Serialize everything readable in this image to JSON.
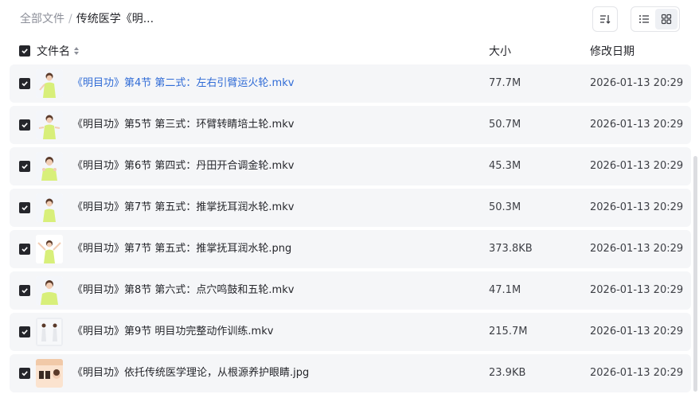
{
  "breadcrumb": {
    "root": "全部文件",
    "separator": "/",
    "current": "传统医学《明..."
  },
  "toolbar": {
    "sort_icon": "sort-order-icon",
    "view_list_icon": "list-view-icon",
    "view_grid_icon": "grid-view-icon"
  },
  "table": {
    "columns": {
      "name": "文件名",
      "size": "大小",
      "date": "修改日期"
    },
    "rows": [
      {
        "name": "《明目功》第4节 第二式：左右引臂运火轮.mkv",
        "size": "77.7M",
        "date": "2026-01-13 20:29",
        "type": "video"
      },
      {
        "name": "《明目功》第5节 第三式：环臂转睛培土轮.mkv",
        "size": "50.7M",
        "date": "2026-01-13 20:29",
        "type": "video"
      },
      {
        "name": "《明目功》第6节 第四式：丹田开合调金轮.mkv",
        "size": "45.3M",
        "date": "2026-01-13 20:29",
        "type": "video"
      },
      {
        "name": "《明目功》第7节 第五式：推掌抚耳润水轮.mkv",
        "size": "50.3M",
        "date": "2026-01-13 20:29",
        "type": "video"
      },
      {
        "name": "《明目功》第7节 第五式：推掌抚耳润水轮.png",
        "size": "373.8KB",
        "date": "2026-01-13 20:29",
        "type": "image"
      },
      {
        "name": "《明目功》第8节 第六式：点穴鸣鼓和五轮.mkv",
        "size": "47.1M",
        "date": "2026-01-13 20:29",
        "type": "video"
      },
      {
        "name": "《明目功》第9节 明目功完整动作训练.mkv",
        "size": "215.7M",
        "date": "2026-01-13 20:29",
        "type": "video-group"
      },
      {
        "name": "《明目功》依托传统医学理论，从根源养护眼睛.jpg",
        "size": "23.9KB",
        "date": "2026-01-13 20:29",
        "type": "poster"
      }
    ]
  },
  "colors": {
    "accent_link": "#2f6bd6",
    "row_bg": "#f5f6f8",
    "checkbox": "#25262b"
  }
}
